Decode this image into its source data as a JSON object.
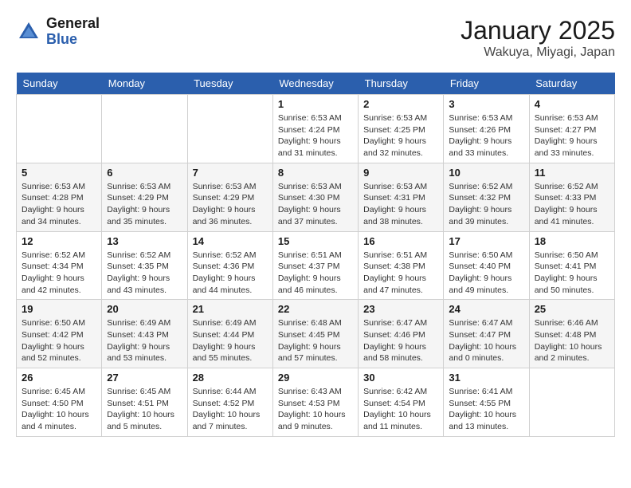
{
  "header": {
    "logo_general": "General",
    "logo_blue": "Blue",
    "month_title": "January 2025",
    "location": "Wakuya, Miyagi, Japan"
  },
  "weekdays": [
    "Sunday",
    "Monday",
    "Tuesday",
    "Wednesday",
    "Thursday",
    "Friday",
    "Saturday"
  ],
  "weeks": [
    [
      {
        "day": "",
        "info": ""
      },
      {
        "day": "",
        "info": ""
      },
      {
        "day": "",
        "info": ""
      },
      {
        "day": "1",
        "info": "Sunrise: 6:53 AM\nSunset: 4:24 PM\nDaylight: 9 hours\nand 31 minutes."
      },
      {
        "day": "2",
        "info": "Sunrise: 6:53 AM\nSunset: 4:25 PM\nDaylight: 9 hours\nand 32 minutes."
      },
      {
        "day": "3",
        "info": "Sunrise: 6:53 AM\nSunset: 4:26 PM\nDaylight: 9 hours\nand 33 minutes."
      },
      {
        "day": "4",
        "info": "Sunrise: 6:53 AM\nSunset: 4:27 PM\nDaylight: 9 hours\nand 33 minutes."
      }
    ],
    [
      {
        "day": "5",
        "info": "Sunrise: 6:53 AM\nSunset: 4:28 PM\nDaylight: 9 hours\nand 34 minutes."
      },
      {
        "day": "6",
        "info": "Sunrise: 6:53 AM\nSunset: 4:29 PM\nDaylight: 9 hours\nand 35 minutes."
      },
      {
        "day": "7",
        "info": "Sunrise: 6:53 AM\nSunset: 4:29 PM\nDaylight: 9 hours\nand 36 minutes."
      },
      {
        "day": "8",
        "info": "Sunrise: 6:53 AM\nSunset: 4:30 PM\nDaylight: 9 hours\nand 37 minutes."
      },
      {
        "day": "9",
        "info": "Sunrise: 6:53 AM\nSunset: 4:31 PM\nDaylight: 9 hours\nand 38 minutes."
      },
      {
        "day": "10",
        "info": "Sunrise: 6:52 AM\nSunset: 4:32 PM\nDaylight: 9 hours\nand 39 minutes."
      },
      {
        "day": "11",
        "info": "Sunrise: 6:52 AM\nSunset: 4:33 PM\nDaylight: 9 hours\nand 41 minutes."
      }
    ],
    [
      {
        "day": "12",
        "info": "Sunrise: 6:52 AM\nSunset: 4:34 PM\nDaylight: 9 hours\nand 42 minutes."
      },
      {
        "day": "13",
        "info": "Sunrise: 6:52 AM\nSunset: 4:35 PM\nDaylight: 9 hours\nand 43 minutes."
      },
      {
        "day": "14",
        "info": "Sunrise: 6:52 AM\nSunset: 4:36 PM\nDaylight: 9 hours\nand 44 minutes."
      },
      {
        "day": "15",
        "info": "Sunrise: 6:51 AM\nSunset: 4:37 PM\nDaylight: 9 hours\nand 46 minutes."
      },
      {
        "day": "16",
        "info": "Sunrise: 6:51 AM\nSunset: 4:38 PM\nDaylight: 9 hours\nand 47 minutes."
      },
      {
        "day": "17",
        "info": "Sunrise: 6:50 AM\nSunset: 4:40 PM\nDaylight: 9 hours\nand 49 minutes."
      },
      {
        "day": "18",
        "info": "Sunrise: 6:50 AM\nSunset: 4:41 PM\nDaylight: 9 hours\nand 50 minutes."
      }
    ],
    [
      {
        "day": "19",
        "info": "Sunrise: 6:50 AM\nSunset: 4:42 PM\nDaylight: 9 hours\nand 52 minutes."
      },
      {
        "day": "20",
        "info": "Sunrise: 6:49 AM\nSunset: 4:43 PM\nDaylight: 9 hours\nand 53 minutes."
      },
      {
        "day": "21",
        "info": "Sunrise: 6:49 AM\nSunset: 4:44 PM\nDaylight: 9 hours\nand 55 minutes."
      },
      {
        "day": "22",
        "info": "Sunrise: 6:48 AM\nSunset: 4:45 PM\nDaylight: 9 hours\nand 57 minutes."
      },
      {
        "day": "23",
        "info": "Sunrise: 6:47 AM\nSunset: 4:46 PM\nDaylight: 9 hours\nand 58 minutes."
      },
      {
        "day": "24",
        "info": "Sunrise: 6:47 AM\nSunset: 4:47 PM\nDaylight: 10 hours\nand 0 minutes."
      },
      {
        "day": "25",
        "info": "Sunrise: 6:46 AM\nSunset: 4:48 PM\nDaylight: 10 hours\nand 2 minutes."
      }
    ],
    [
      {
        "day": "26",
        "info": "Sunrise: 6:45 AM\nSunset: 4:50 PM\nDaylight: 10 hours\nand 4 minutes."
      },
      {
        "day": "27",
        "info": "Sunrise: 6:45 AM\nSunset: 4:51 PM\nDaylight: 10 hours\nand 5 minutes."
      },
      {
        "day": "28",
        "info": "Sunrise: 6:44 AM\nSunset: 4:52 PM\nDaylight: 10 hours\nand 7 minutes."
      },
      {
        "day": "29",
        "info": "Sunrise: 6:43 AM\nSunset: 4:53 PM\nDaylight: 10 hours\nand 9 minutes."
      },
      {
        "day": "30",
        "info": "Sunrise: 6:42 AM\nSunset: 4:54 PM\nDaylight: 10 hours\nand 11 minutes."
      },
      {
        "day": "31",
        "info": "Sunrise: 6:41 AM\nSunset: 4:55 PM\nDaylight: 10 hours\nand 13 minutes."
      },
      {
        "day": "",
        "info": ""
      }
    ]
  ]
}
